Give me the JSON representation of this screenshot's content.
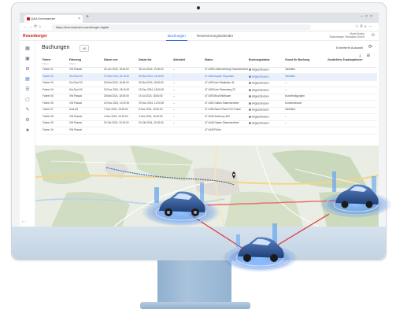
{
  "browser": {
    "tab_title": "Q&A Kommander",
    "url": "https://kommander.rosenberger.digital"
  },
  "app": {
    "brand": "Rosenberger",
    "tabs": [
      {
        "label": "Buchungen"
      },
      {
        "label": "Reservierungskalender"
      }
    ],
    "user_name": "Maria Muster",
    "user_org": "Rosenberger Telematics GmbH"
  },
  "page": {
    "title": "Buchungen",
    "count": "40",
    "filter_label": "Filter",
    "filter_link": "Erweiterte Auswahl"
  },
  "table": {
    "headers": [
      "Fahrer",
      "Fahrzeug",
      "Datum von",
      "Datum bis",
      "Abholzeit",
      "Status",
      "Buchungsstatus",
      "Grund für Buchung",
      "Zusätzliche Zusatzoptionen"
    ],
    "filters": [
      "Filtern",
      "Filtern"
    ],
    "rows": [
      [
        "Fahrer 01",
        "VW Passat",
        "25 Jun 2024, 18:00:00",
        "25 Jun 2024, 19:00:00",
        "–",
        "47 4495 Leiteinrichtung Parkunterbrechung",
        "Abgeschlossen",
        "Tankfahrt",
        ""
      ],
      [
        "Fahrer 02",
        "Kia Soul EV",
        "27 Mar 2024, 06:15:30",
        "30 Mar 2024, 18:00:00",
        "–",
        "47 4495 Aspern Reparatur",
        "Abgeschlossen",
        "Tankfahrt",
        ""
      ],
      [
        "Fahrer 03",
        "Kia Soul EV",
        "28 Mai 2024, 16:54:00",
        "30 Mai 2024, 18:00:00",
        "–",
        "47 4493 Irdu Stadtplatz 46",
        "Abgeschlossen",
        "–",
        ""
      ],
      [
        "Fahrer 04",
        "Kia Soul EV",
        "20 Dez 2024, 18:16:00",
        "19 Dez 2024, 18:00:00",
        "–",
        "47 4493 Irdu Petersberg 23",
        "Abgeschlossen",
        "–",
        ""
      ],
      [
        "Fahrer 05",
        "VW Passat",
        "28 Mai 2024, 18:00:00",
        "19 Jul 2024, 18:00:00",
        "–",
        "47 4493 Bruchhöfbauer",
        "Abgeschlossen",
        "Kurz­erledigungen",
        ""
      ],
      [
        "Fahrer 06",
        "VW Passat",
        "20 Nov 2024, 12:00:00",
        "19 Nov 2024, 12:00:00",
        "–",
        "47 4450 Gabes Stammereibee",
        "Abgeschlossen",
        "Kundenbesuch",
        ""
      ],
      [
        "Fahrer 07",
        "Audi A3",
        "7 Nov 2024, 15:30:00",
        "8 Nov 2024, 15:30:00",
        "–",
        "47 4155 Sanct Plaza Firrl-Thane",
        "Abgeschlossen",
        "Tankfahrt",
        ""
      ],
      [
        "Fahrer 08",
        "VW Passat",
        "4 Nov 2024, 10:15:00",
        "4 Nov 2024, 16:15:00",
        "–",
        "47 4445 Zschorny 46C",
        "Abgeschlossen",
        "–",
        ""
      ],
      [
        "Fahrer 09",
        "VW Passat",
        "20 Okt 2024, 12:00:00",
        "20 Okt 2024, 20:00:00",
        "–",
        "47 4445 Gabes Stammereibee",
        "Abgeschlossen",
        "–",
        ""
      ],
      [
        "Fahrer 10",
        "VW Passat",
        "",
        "",
        "",
        "47 4449 Fürke",
        "",
        "",
        ""
      ]
    ]
  },
  "colors": {
    "brand": "#c81e1e",
    "accent": "#2f6fdc",
    "glow": "#3b82f6",
    "car": "#2b4f8c",
    "link_line": "#e23b3b"
  }
}
